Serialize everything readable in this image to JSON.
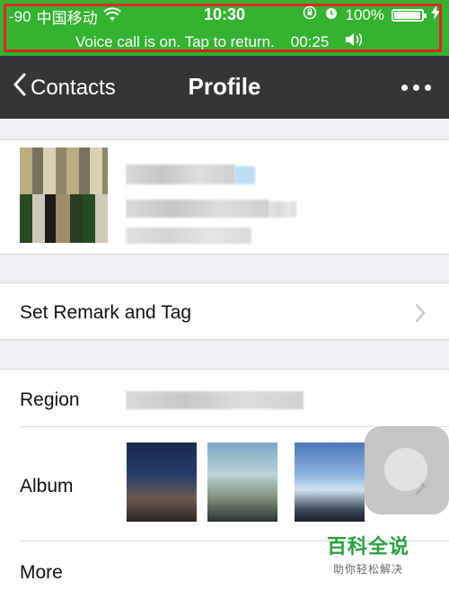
{
  "status_bar": {
    "signal": "-90",
    "carrier": "中国移动",
    "time": "10:30",
    "battery_percent": "100%",
    "battery_level": 0.95,
    "accent": "#33b32f"
  },
  "call_banner": {
    "text": "Voice call is on. Tap to return.",
    "duration": "00:25"
  },
  "nav": {
    "back_label": "Contacts",
    "title": "Profile"
  },
  "cells": {
    "remark_label": "Set Remark and Tag",
    "region_label": "Region",
    "album_label": "Album",
    "more_label": "More"
  },
  "watermark": {
    "main": "百科全说",
    "sub": "助你轻松解决"
  }
}
